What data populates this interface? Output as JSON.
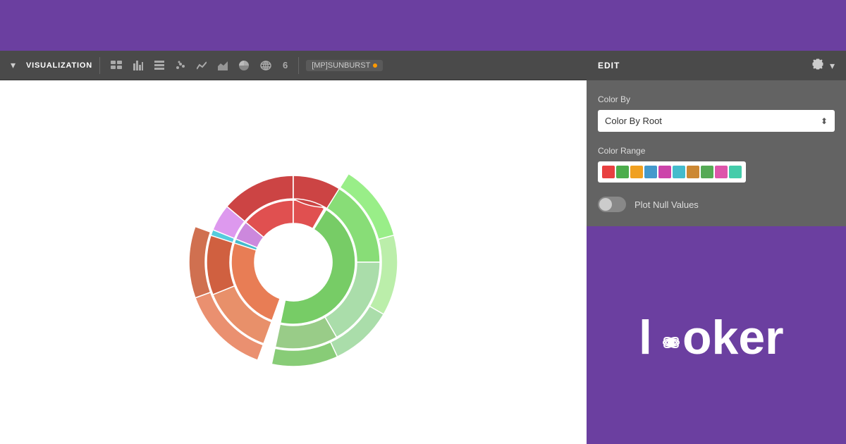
{
  "toolbar": {
    "visualization_label": "VISUALIZATION",
    "chart_type_label": "[MP]SUNBURST",
    "edit_label": "EDIT",
    "icons": [
      {
        "name": "table-icon",
        "symbol": "⊞"
      },
      {
        "name": "bar-chart-icon",
        "symbol": "▐"
      },
      {
        "name": "list-icon",
        "symbol": "≡"
      },
      {
        "name": "scatter-icon",
        "symbol": "⁙"
      },
      {
        "name": "line-chart-icon",
        "symbol": "∿"
      },
      {
        "name": "area-chart-icon",
        "symbol": "◿"
      },
      {
        "name": "pie-chart-icon",
        "symbol": "◔"
      },
      {
        "name": "map-icon",
        "symbol": "⊕"
      },
      {
        "name": "number-icon",
        "symbol": "6"
      }
    ]
  },
  "edit_panel": {
    "title": "EDIT",
    "color_by_label": "Color By",
    "color_by_value": "Color By Root",
    "color_range_label": "Color Range",
    "plot_null_label": "Plot Null Values",
    "swatches": [
      "#e84040",
      "#4cad4c",
      "#f0a020",
      "#4499cc",
      "#cc44aa",
      "#44bbcc",
      "#cc8833",
      "#55aa55",
      "#dd55aa",
      "#44ccaa"
    ]
  },
  "looker": {
    "brand_name": "looker"
  },
  "colors": {
    "purple": "#6b3fa0",
    "toolbar_bg": "#4a4a4a",
    "panel_bg": "#636363"
  }
}
